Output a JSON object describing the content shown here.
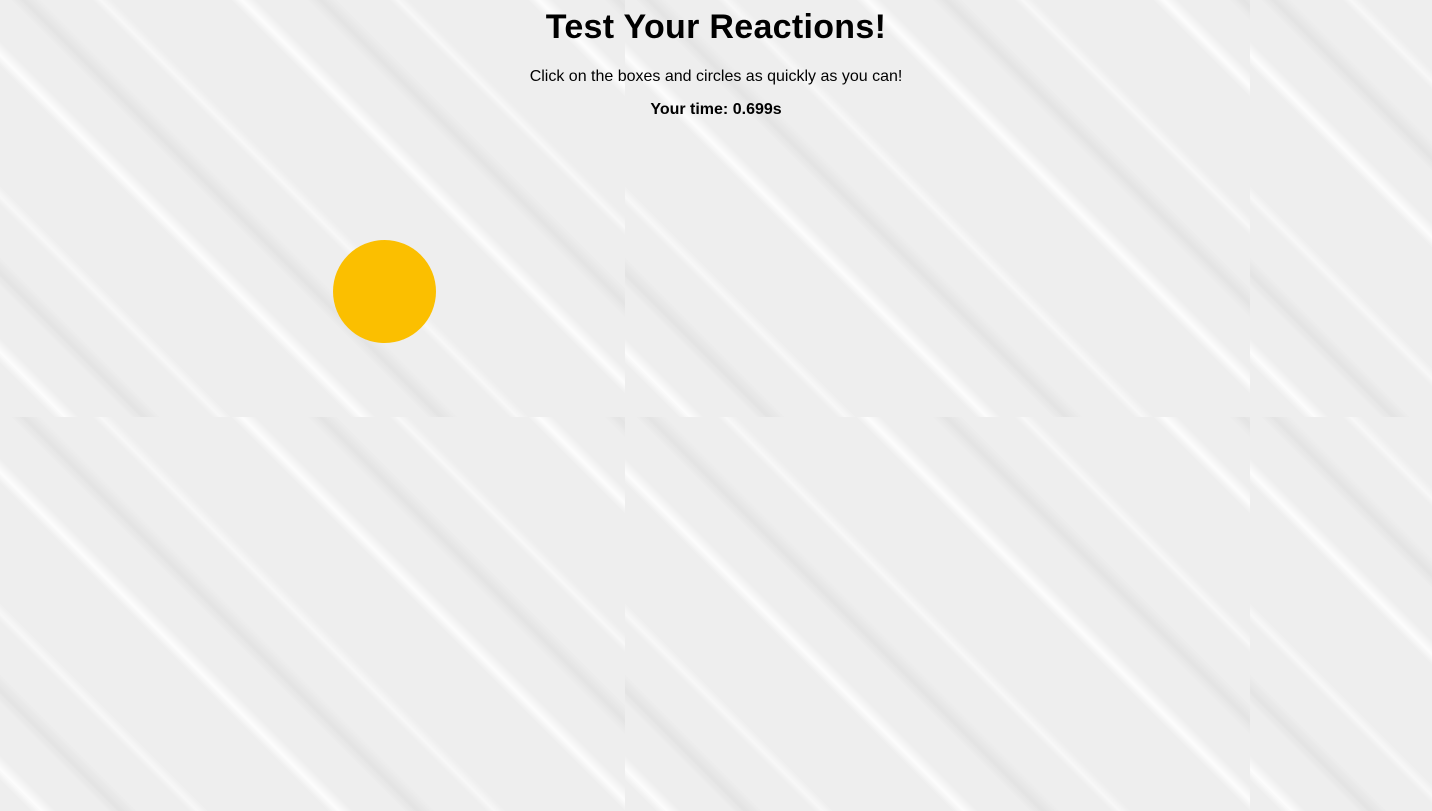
{
  "page": {
    "title": "Test Your Reactions!",
    "instructions": "Click on the boxes and circles as quickly as you can!"
  },
  "result": {
    "label": "Your time:",
    "value": "0.699s"
  },
  "target": {
    "shape": "circle",
    "color": "#FBBF00"
  }
}
